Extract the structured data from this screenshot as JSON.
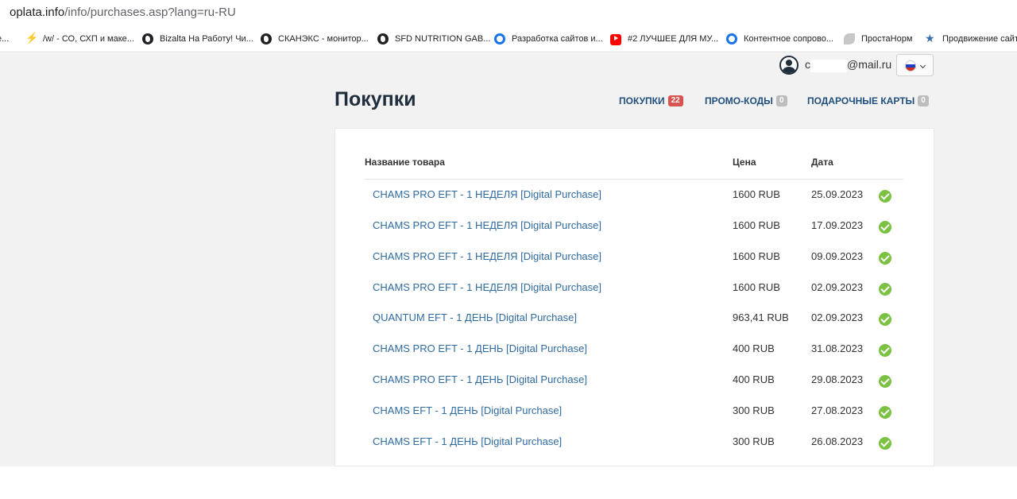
{
  "browser": {
    "url_host": "oplata.info",
    "url_path": "/info/purchases.asp?lang=ru-RU",
    "bookmarks": [
      {
        "label": "е...",
        "icon": "none"
      },
      {
        "label": "/w/ - СО, СХП и маке...",
        "icon": "bolt-icon"
      },
      {
        "label": "Bizalta На Работу! Чи...",
        "icon": "globe-icon"
      },
      {
        "label": "СКАНЭКС - монитор...",
        "icon": "globe-icon"
      },
      {
        "label": "SFD NUTRITION GAB...",
        "icon": "globe-icon"
      },
      {
        "label": "Разработка сайтов и...",
        "icon": "g-icon"
      },
      {
        "label": "#2 ЛУЧШЕЕ ДЛЯ МУ...",
        "icon": "youtube-icon"
      },
      {
        "label": "Контентное сопрово...",
        "icon": "g-icon"
      },
      {
        "label": "ПростаНорм",
        "icon": "leaf-icon"
      },
      {
        "label": "Продвижение сайт",
        "icon": "star-icon"
      }
    ]
  },
  "header": {
    "email_start": "с",
    "email_domain": "@mail.ru",
    "language_flag": "ru"
  },
  "page": {
    "title": "Покупки",
    "tabs": [
      {
        "label": "ПОКУПКИ",
        "count": "22",
        "color": "#d9534f"
      },
      {
        "label": "ПРОМО-КОДЫ",
        "count": "0",
        "color": "#bdbdbd"
      },
      {
        "label": "ПОДАРОЧНЫЕ КАРТЫ",
        "count": "0",
        "color": "#bdbdbd"
      }
    ]
  },
  "table": {
    "columns": [
      "Название товара",
      "Цена",
      "Дата"
    ],
    "rows": [
      {
        "name": "CHAMS PRO EFT - 1 НЕДЕЛЯ [Digital Purchase]",
        "price": "1600 RUB",
        "date": "25.09.2023"
      },
      {
        "name": "CHAMS PRO EFT - 1 НЕДЕЛЯ [Digital Purchase]",
        "price": "1600 RUB",
        "date": "17.09.2023"
      },
      {
        "name": "CHAMS PRO EFT - 1 НЕДЕЛЯ [Digital Purchase]",
        "price": "1600 RUB",
        "date": "09.09.2023"
      },
      {
        "name": "CHAMS PRO EFT - 1 НЕДЕЛЯ [Digital Purchase]",
        "price": "1600 RUB",
        "date": "02.09.2023"
      },
      {
        "name": "QUANTUM EFT - 1 ДЕНЬ [Digital Purchase]",
        "price": "963,41 RUB",
        "date": "02.09.2023"
      },
      {
        "name": "CHAMS PRO EFT - 1 ДЕНЬ [Digital Purchase]",
        "price": "400 RUB",
        "date": "31.08.2023"
      },
      {
        "name": "CHAMS PRO EFT - 1 ДЕНЬ [Digital Purchase]",
        "price": "400 RUB",
        "date": "29.08.2023"
      },
      {
        "name": "CHAMS EFT - 1 ДЕНЬ [Digital Purchase]",
        "price": "300 RUB",
        "date": "27.08.2023"
      },
      {
        "name": "CHAMS EFT - 1 ДЕНЬ [Digital Purchase]",
        "price": "300 RUB",
        "date": "26.08.2023"
      }
    ],
    "status_icon": "check-circle-icon",
    "status_color": "#7cc242"
  }
}
